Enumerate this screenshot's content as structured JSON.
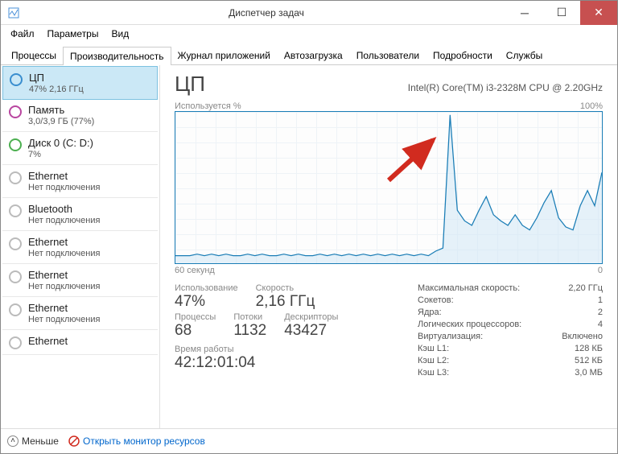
{
  "window": {
    "title": "Диспетчер задач"
  },
  "menu": {
    "file": "Файл",
    "options": "Параметры",
    "view": "Вид"
  },
  "tabs": {
    "items": [
      {
        "label": "Процессы"
      },
      {
        "label": "Производительность"
      },
      {
        "label": "Журнал приложений"
      },
      {
        "label": "Автозагрузка"
      },
      {
        "label": "Пользователи"
      },
      {
        "label": "Подробности"
      },
      {
        "label": "Службы"
      }
    ],
    "activeIndex": 1
  },
  "sidebar": {
    "items": [
      {
        "title": "ЦП",
        "sub": "47% 2,16 ГГц",
        "selected": true,
        "ring": "blue"
      },
      {
        "title": "Память",
        "sub": "3,0/3,9 ГБ (77%)",
        "ring": "purple"
      },
      {
        "title": "Диск 0 (C: D:)",
        "sub": "7%",
        "ring": "green"
      },
      {
        "title": "Ethernet",
        "sub": "Нет подключения",
        "ring": ""
      },
      {
        "title": "Bluetooth",
        "sub": "Нет подключения",
        "ring": ""
      },
      {
        "title": "Ethernet",
        "sub": "Нет подключения",
        "ring": ""
      },
      {
        "title": "Ethernet",
        "sub": "Нет подключения",
        "ring": ""
      },
      {
        "title": "Ethernet",
        "sub": "Нет подключения",
        "ring": ""
      },
      {
        "title": "Ethernet",
        "sub": "",
        "ring": ""
      }
    ]
  },
  "main": {
    "title": "ЦП",
    "model": "Intel(R) Core(TM) i3-2328M CPU @ 2.20GHz",
    "yLabel": "Используется %",
    "yMax": "100%",
    "xLeft": "60 секунд",
    "xRight": "0",
    "stats": {
      "usage_lbl": "Использование",
      "usage_val": "47%",
      "speed_lbl": "Скорость",
      "speed_val": "2,16 ГГц",
      "proc_lbl": "Процессы",
      "proc_val": "68",
      "threads_lbl": "Потоки",
      "threads_val": "1132",
      "handles_lbl": "Дескрипторы",
      "handles_val": "43427",
      "uptime_lbl": "Время работы",
      "uptime_val": "42:12:01:04"
    },
    "info": {
      "maxspeed_lbl": "Максимальная скорость:",
      "maxspeed_val": "2,20 ГГц",
      "sockets_lbl": "Сокетов:",
      "sockets_val": "1",
      "cores_lbl": "Ядра:",
      "cores_val": "2",
      "logical_lbl": "Логических процессоров:",
      "logical_val": "4",
      "virt_lbl": "Виртуализация:",
      "virt_val": "Включено",
      "l1_lbl": "Кэш L1:",
      "l1_val": "128 КБ",
      "l2_lbl": "Кэш L2:",
      "l2_val": "512 КБ",
      "l3_lbl": "Кэш L3:",
      "l3_val": "3,0 МБ"
    }
  },
  "chart_data": {
    "type": "line",
    "title": "ЦП — Используется %",
    "xlabel": "секунд",
    "ylabel": "%",
    "x_range_seconds": [
      60,
      0
    ],
    "ylim": [
      0,
      100
    ],
    "values": [
      5,
      5,
      5,
      6,
      5,
      6,
      5,
      6,
      5,
      5,
      6,
      5,
      6,
      5,
      5,
      6,
      5,
      6,
      5,
      5,
      6,
      5,
      6,
      5,
      6,
      5,
      6,
      5,
      6,
      5,
      6,
      5,
      6,
      5,
      6,
      5,
      8,
      10,
      98,
      35,
      28,
      25,
      35,
      44,
      32,
      28,
      25,
      32,
      25,
      22,
      30,
      40,
      48,
      30,
      24,
      22,
      38,
      48,
      38,
      60
    ]
  },
  "footer": {
    "fewer": "Меньше",
    "openrm": "Открыть монитор ресурсов"
  },
  "colors": {
    "accent": "#1a7db6",
    "arrow": "#d12b1f"
  }
}
